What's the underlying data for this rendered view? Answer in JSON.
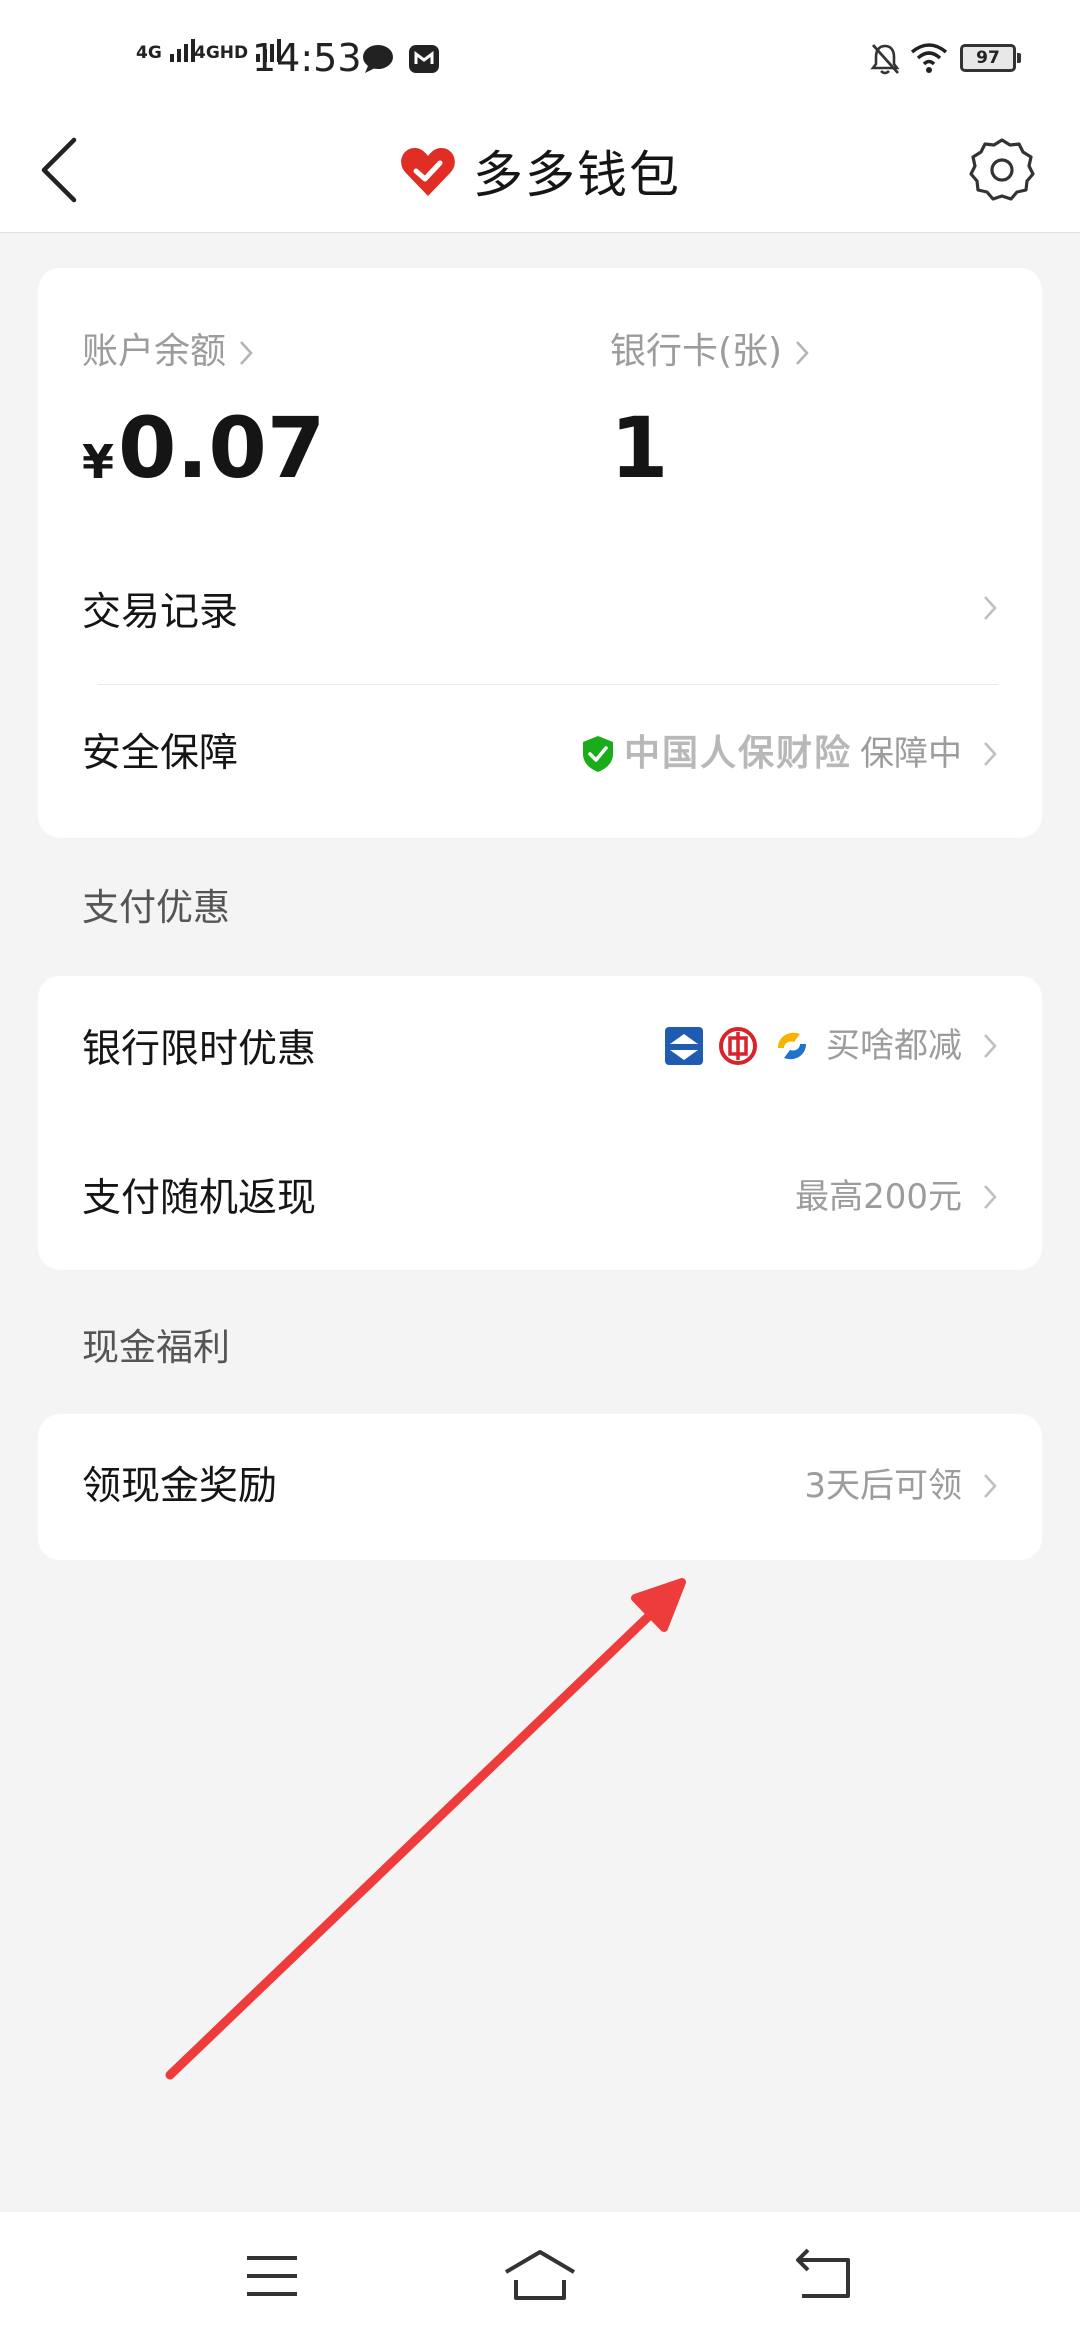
{
  "status_bar": {
    "network_1": "4G",
    "network_2": "4GHD",
    "time": "14:53",
    "battery": "97",
    "icons": [
      "chat-bubble-icon",
      "message-app-icon",
      "bell-off-icon",
      "wifi-icon",
      "battery-icon"
    ]
  },
  "header": {
    "title": "多多钱包",
    "back_icon": "back-chevron-icon",
    "logo_icon": "red-heart-check-logo",
    "settings_icon": "gear-icon"
  },
  "account": {
    "balance_label": "账户余额",
    "balance_currency": "¥",
    "balance_value": "0.07",
    "cards_label": "银行卡(张)",
    "cards_value": "1"
  },
  "menu": {
    "transactions_label": "交易记录",
    "security_label": "安全保障",
    "security_insurer": "中国人保财险",
    "security_status": "保障中"
  },
  "payment_offers": {
    "section_title": "支付优惠",
    "bank_offer_label": "银行限时优惠",
    "bank_offer_right": "买啥都减",
    "bank_icons": [
      "bank-blue-icon",
      "bank-red-icon",
      "bank-yellow-blue-icon"
    ],
    "cashback_label": "支付随机返现",
    "cashback_right": "最高200元"
  },
  "cash_benefits": {
    "section_title": "现金福利",
    "reward_label": "领现金奖励",
    "reward_right": "3天后可领"
  },
  "colors": {
    "brand_red": "#e02e24",
    "shield_green": "#1aad19",
    "annotation_arrow": "#ee3b3b",
    "page_bg": "#f4f4f4"
  },
  "system_nav": {
    "icons": [
      "menu-icon",
      "home-icon",
      "back-icon"
    ]
  }
}
